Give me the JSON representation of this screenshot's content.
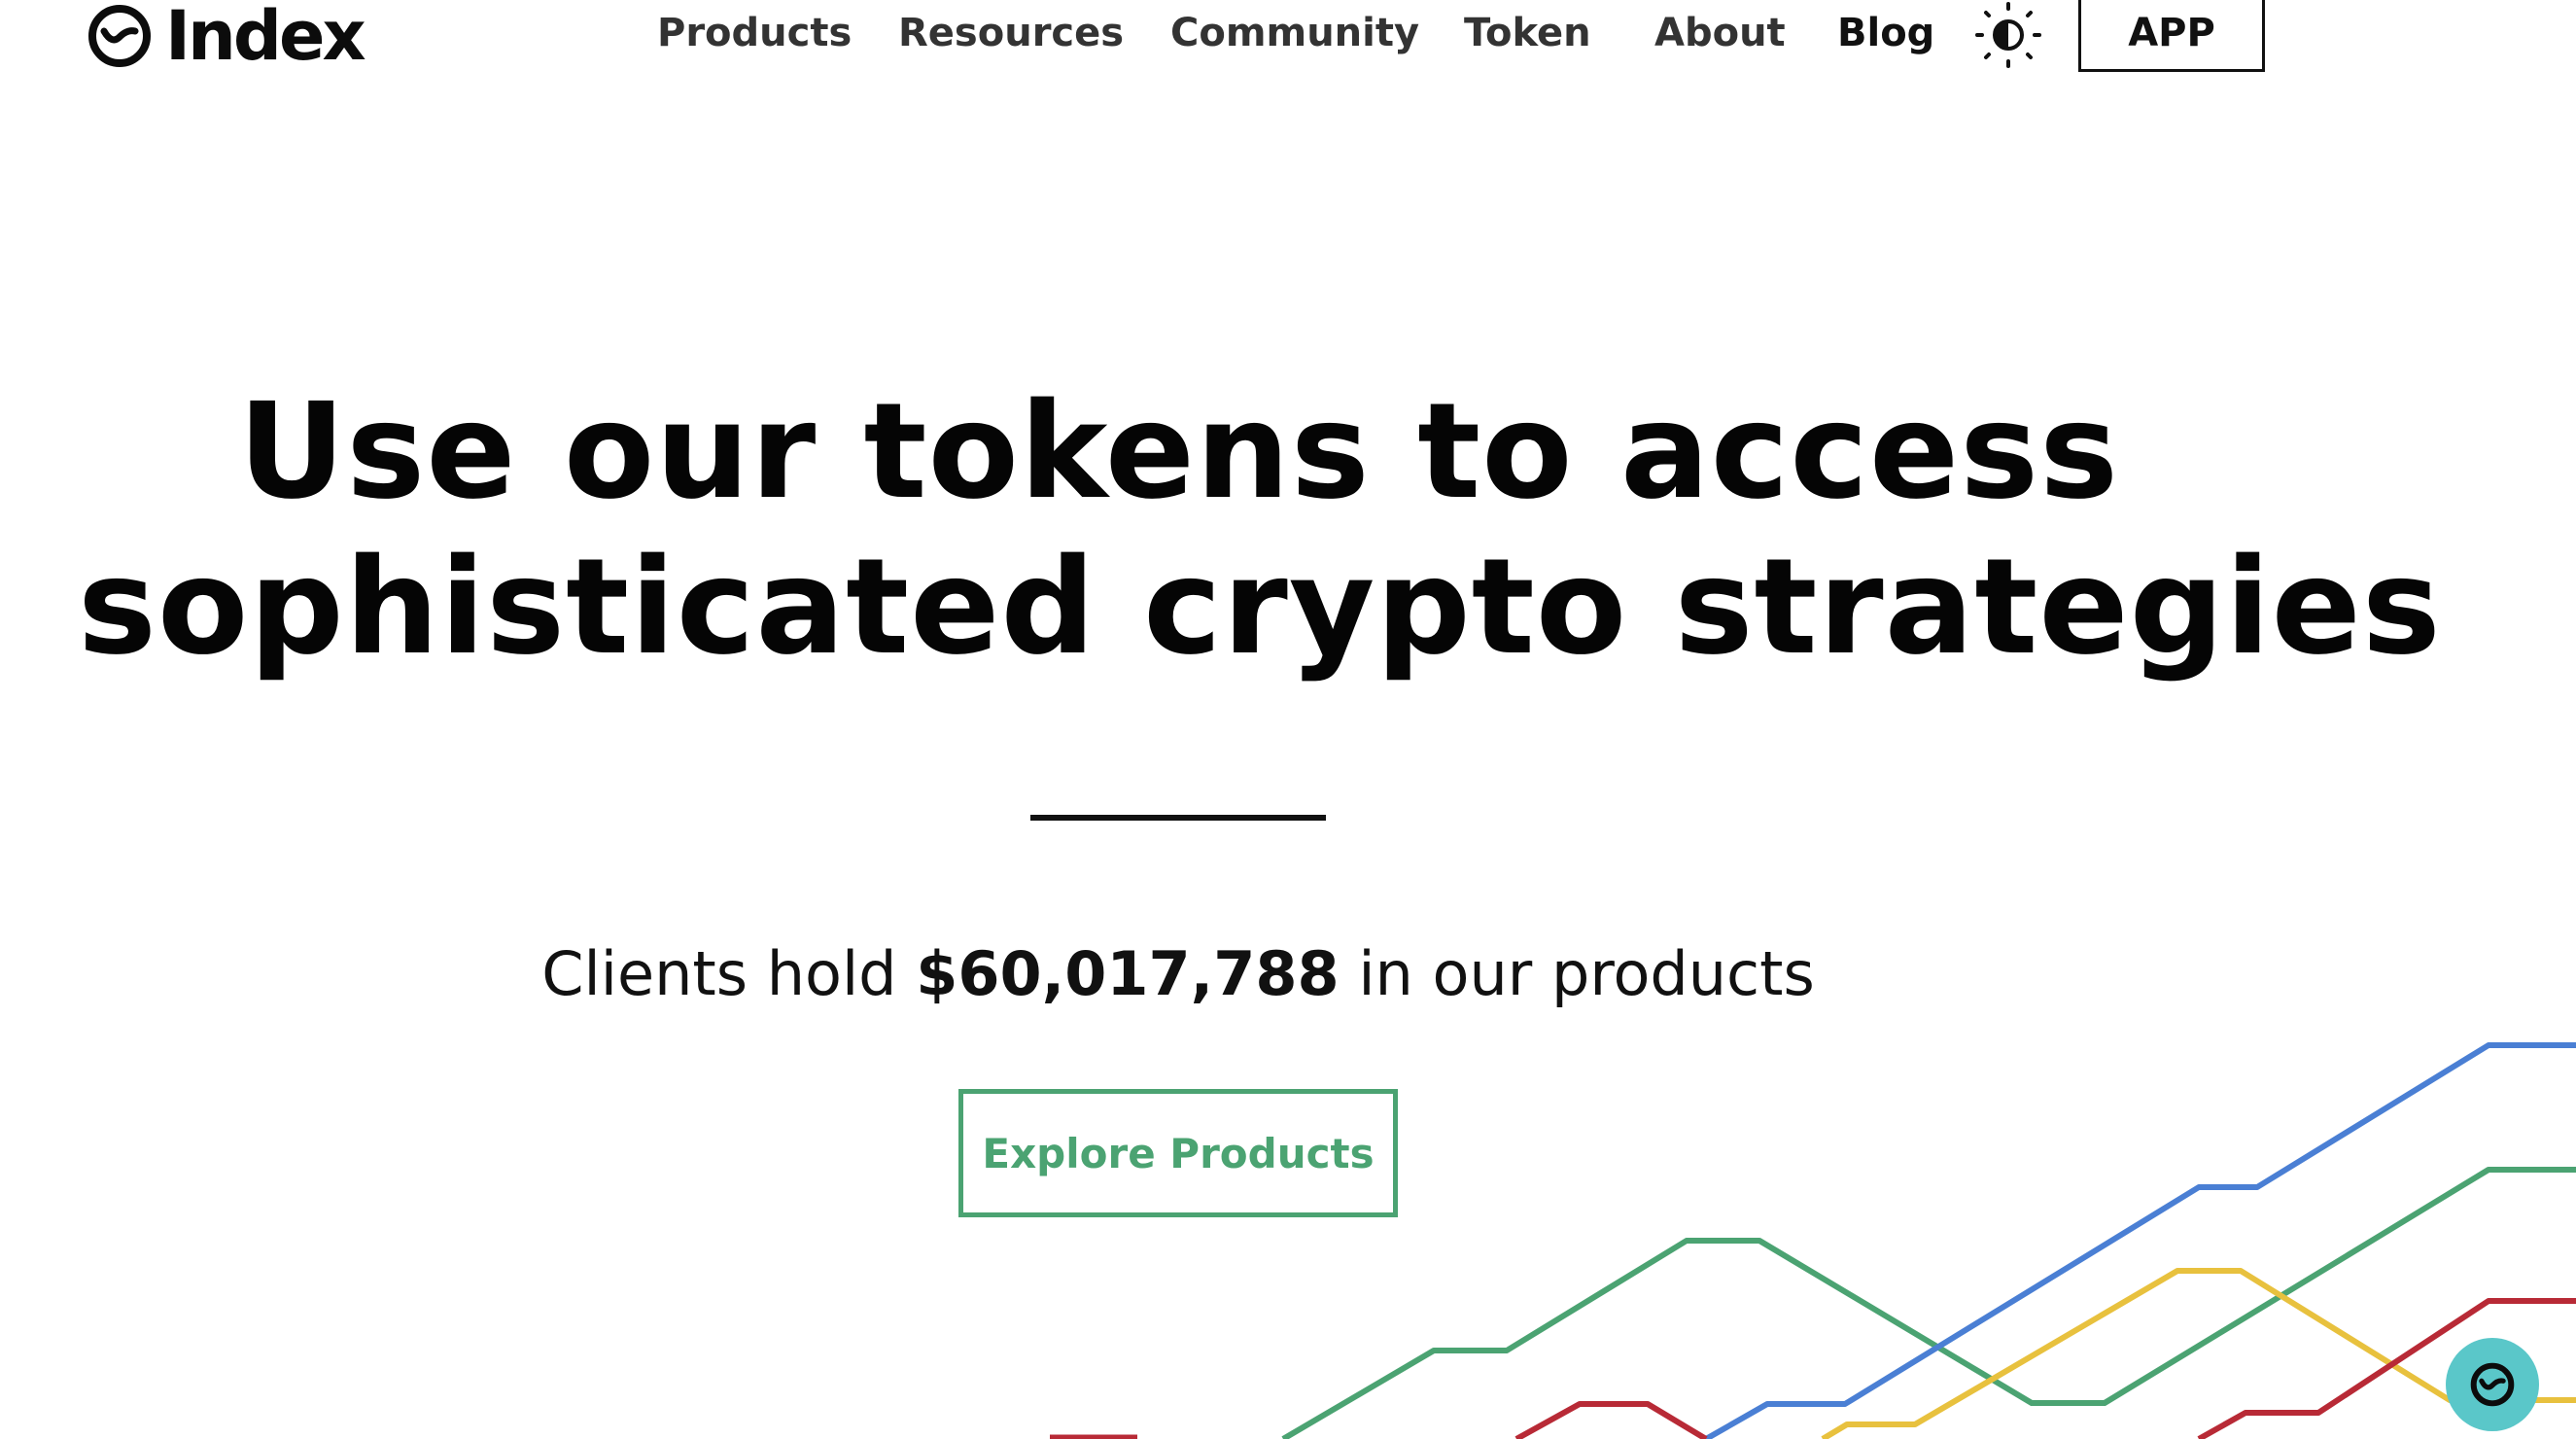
{
  "header": {
    "logo_text": "Index",
    "nav": [
      {
        "label": "Products"
      },
      {
        "label": "Resources"
      },
      {
        "label": "Community"
      },
      {
        "label": "Token"
      },
      {
        "label": "About"
      },
      {
        "label": "Blog"
      }
    ],
    "theme_toggle_icon": "sun-half-icon",
    "app_button": "APP"
  },
  "hero": {
    "title_line1": "Use our tokens to access",
    "title_line2": "sophisticated crypto strategies",
    "clients_prefix": "Clients hold ",
    "clients_amount": "$60,017,788",
    "clients_suffix": " in our products",
    "explore_button": "Explore Products"
  },
  "decoration": {
    "line_colors": [
      "#4a7fd4",
      "#4ba372",
      "#e8c13e",
      "#b82a36"
    ]
  },
  "chat_widget": {
    "icon": "index-logo-icon",
    "color": "#5ac7c9"
  },
  "colors": {
    "accent": "#4ba372",
    "text": "#0c0c0c"
  }
}
